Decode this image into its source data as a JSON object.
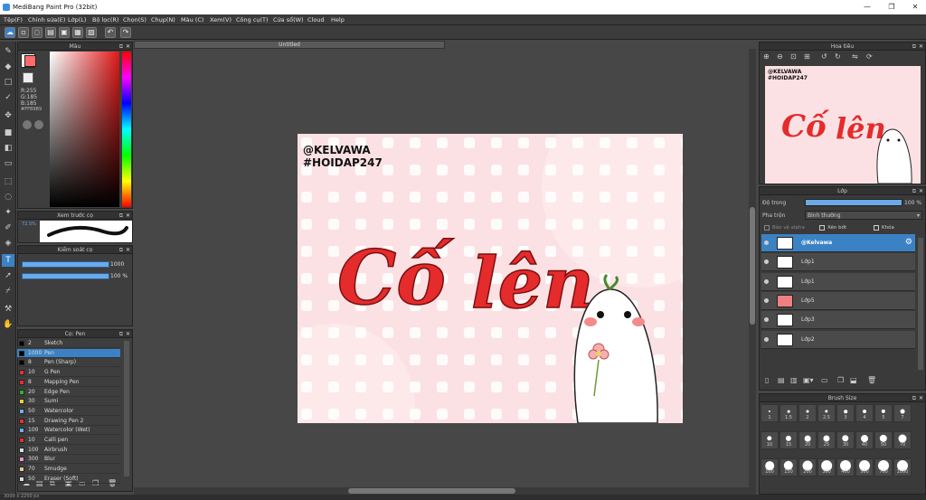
{
  "window": {
    "title": "MediBang Paint Pro (32bit)",
    "minimize": "—",
    "maximize": "❐",
    "close": "✕"
  },
  "menu": [
    "Tệp(F)",
    "Chỉnh sửa(E)",
    "Lớp(L)",
    "Bộ lọc(R)",
    "Chọn(S)",
    "Chụp(N)",
    "Màu (C)",
    "Xem(V)",
    "Công cụ(T)",
    "Cửa sổ(W)",
    "Cloud",
    "Help"
  ],
  "document_tab": "Untitled",
  "color_panel": {
    "title": "Màu",
    "rgb": [
      "R:255",
      "G:185",
      "B:185"
    ],
    "hex": "#FFB9B9",
    "primary_color": "#ff6b6b",
    "secondary_color": "#ffffff"
  },
  "preview_panel": {
    "title": "Xem trước cọ",
    "size_label": "72.5%"
  },
  "brush_control": {
    "title": "Kiểm soát cọ",
    "size_value": "1000",
    "opacity_value": "100 %"
  },
  "brush_panel": {
    "title": "Cọ: Pen",
    "items": [
      {
        "size": "2",
        "name": "Sketch",
        "color": "#000000"
      },
      {
        "size": "1000",
        "name": "Pen",
        "color": "#000000",
        "selected": true
      },
      {
        "size": "8",
        "name": "Pen (Sharp)",
        "color": "#000000"
      },
      {
        "size": "10",
        "name": "G Pen",
        "color": "#e53030"
      },
      {
        "size": "8",
        "name": "Mapping Pen",
        "color": "#e53030"
      },
      {
        "size": "20",
        "name": "Edge Pen",
        "color": "#30b030"
      },
      {
        "size": "30",
        "name": "Sumi",
        "color": "#e8d040"
      },
      {
        "size": "50",
        "name": "Watercolor",
        "color": "#6ab0f0"
      },
      {
        "size": "15",
        "name": "Drawing Pen 2",
        "color": "#e53030"
      },
      {
        "size": "100",
        "name": "Watercolor (Wet)",
        "color": "#6ab0f0"
      },
      {
        "size": "10",
        "name": "Calli pen",
        "color": "#e53030"
      },
      {
        "size": "100",
        "name": "Airbrush",
        "color": "#dddddd"
      },
      {
        "size": "300",
        "name": "Blur",
        "color": "#f090d0"
      },
      {
        "size": "70",
        "name": "Smudge",
        "color": "#e8c890"
      },
      {
        "size": "50",
        "name": "Eraser (Soft)",
        "color": "#dddddd"
      }
    ]
  },
  "canvas": {
    "handle1": "@KELVAWA",
    "handle2": "#HOIDAP247",
    "word1": "Cố",
    "word2": "lên"
  },
  "navigator": {
    "title": "Hoa tiêu",
    "handle1": "@KELVAWA",
    "handle2": "#HOIDAP247",
    "word1": "Cố",
    "word2": "lên"
  },
  "layer_panel": {
    "title": "Lớp",
    "opacity_label": "Độ trong",
    "opacity_value": "100 %",
    "opacity_fraction": 1.0,
    "blend_label": "Pha trộn",
    "blend_value": "Bình thường",
    "protect_alpha": "Bảo vệ alpha",
    "clipping": "Xén bớt",
    "lock": "Khóa",
    "layers": [
      {
        "name": "@Kelvawa",
        "selected": true
      },
      {
        "name": "Lớp1"
      },
      {
        "name": "Lớp1"
      },
      {
        "name": "Lớp5"
      },
      {
        "name": "Lớp3"
      },
      {
        "name": "Lớp2"
      }
    ]
  },
  "brush_size_panel": {
    "title": "Brush Size",
    "sizes": [
      "1",
      "1.5",
      "2",
      "2.5",
      "3",
      "4",
      "5",
      "7",
      "10",
      "15",
      "20",
      "25",
      "30",
      "40",
      "50",
      "70",
      "100",
      "150",
      "200",
      "300",
      "400",
      "500",
      "700",
      "1000"
    ]
  },
  "status": {
    "text": "3000 x 2250 px"
  }
}
